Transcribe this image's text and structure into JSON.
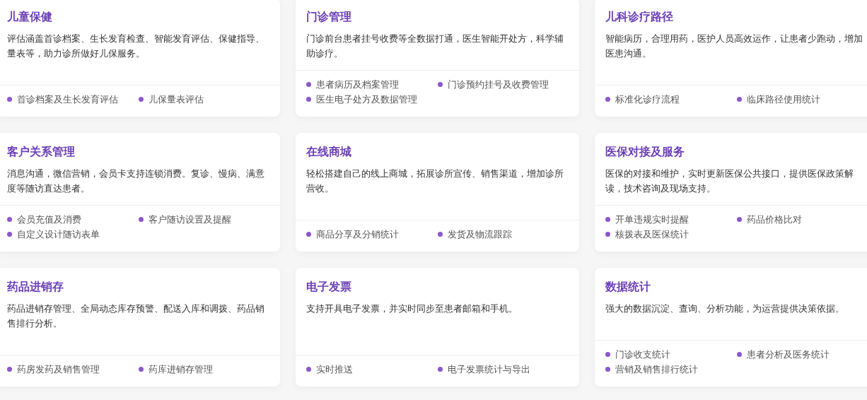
{
  "cards": [
    {
      "title": "儿童保健",
      "description": "评估涵盖首诊档案、生长发育检查、智能发育评估、保健指导、量表等，助力诊所做好儿保服务。",
      "features": [
        "首诊档案及生长发育评估",
        "儿保量表评估"
      ]
    },
    {
      "title": "门诊管理",
      "description": "门诊前台患者挂号收费等全数据打通，医生智能开处方，科学辅助诊疗。",
      "features": [
        "患者病历及档案管理",
        "门诊预约挂号及收费管理",
        "医生电子处方及数据管理"
      ]
    },
    {
      "title": "儿科诊疗路径",
      "description": "智能病历，合理用药，医护人员高效运作，让患者少跑动，增加医患沟通。",
      "features": [
        "标准化诊疗流程",
        "临床路径使用统计"
      ]
    },
    {
      "title": "客户关系管理",
      "description": "消息沟通，微信营销，会员卡支持连锁消费。复诊、慢病、满意度等随访直达患者。",
      "features": [
        "会员充值及消费",
        "客户随访设置及提醒",
        "自定义设计随访表单"
      ]
    },
    {
      "title": "在线商城",
      "description": "轻松搭建自己的线上商城，拓展诊所宣传、销售渠道，增加诊所营收。",
      "features": [
        "商品分享及分销统计",
        "发货及物流跟踪"
      ]
    },
    {
      "title": "医保对接及服务",
      "description": "医保的对接和维护，实时更新医保公共接口，提供医保政策解读，技术咨询及现场支持。",
      "features": [
        "开单违规实时提醒",
        "药品价格比对",
        "核拨表及医保统计"
      ]
    },
    {
      "title": "药品进销存",
      "description": "药品进销存管理、全局动态库存预警、配送入库和调拨、药品销售排行分析。",
      "features": [
        "药房发药及销售管理",
        "药库进销存管理"
      ]
    },
    {
      "title": "电子发票",
      "description": "支持开具电子发票，并实时同步至患者邮箱和手机。",
      "features": [
        "实时推送",
        "电子发票统计与导出"
      ]
    },
    {
      "title": "数据统计",
      "description": "强大的数据沉淀、查询、分析功能，为运营提供决策依据。",
      "features": [
        "门诊收支统计",
        "患者分析及医务统计",
        "营销及销售排行统计"
      ]
    }
  ]
}
